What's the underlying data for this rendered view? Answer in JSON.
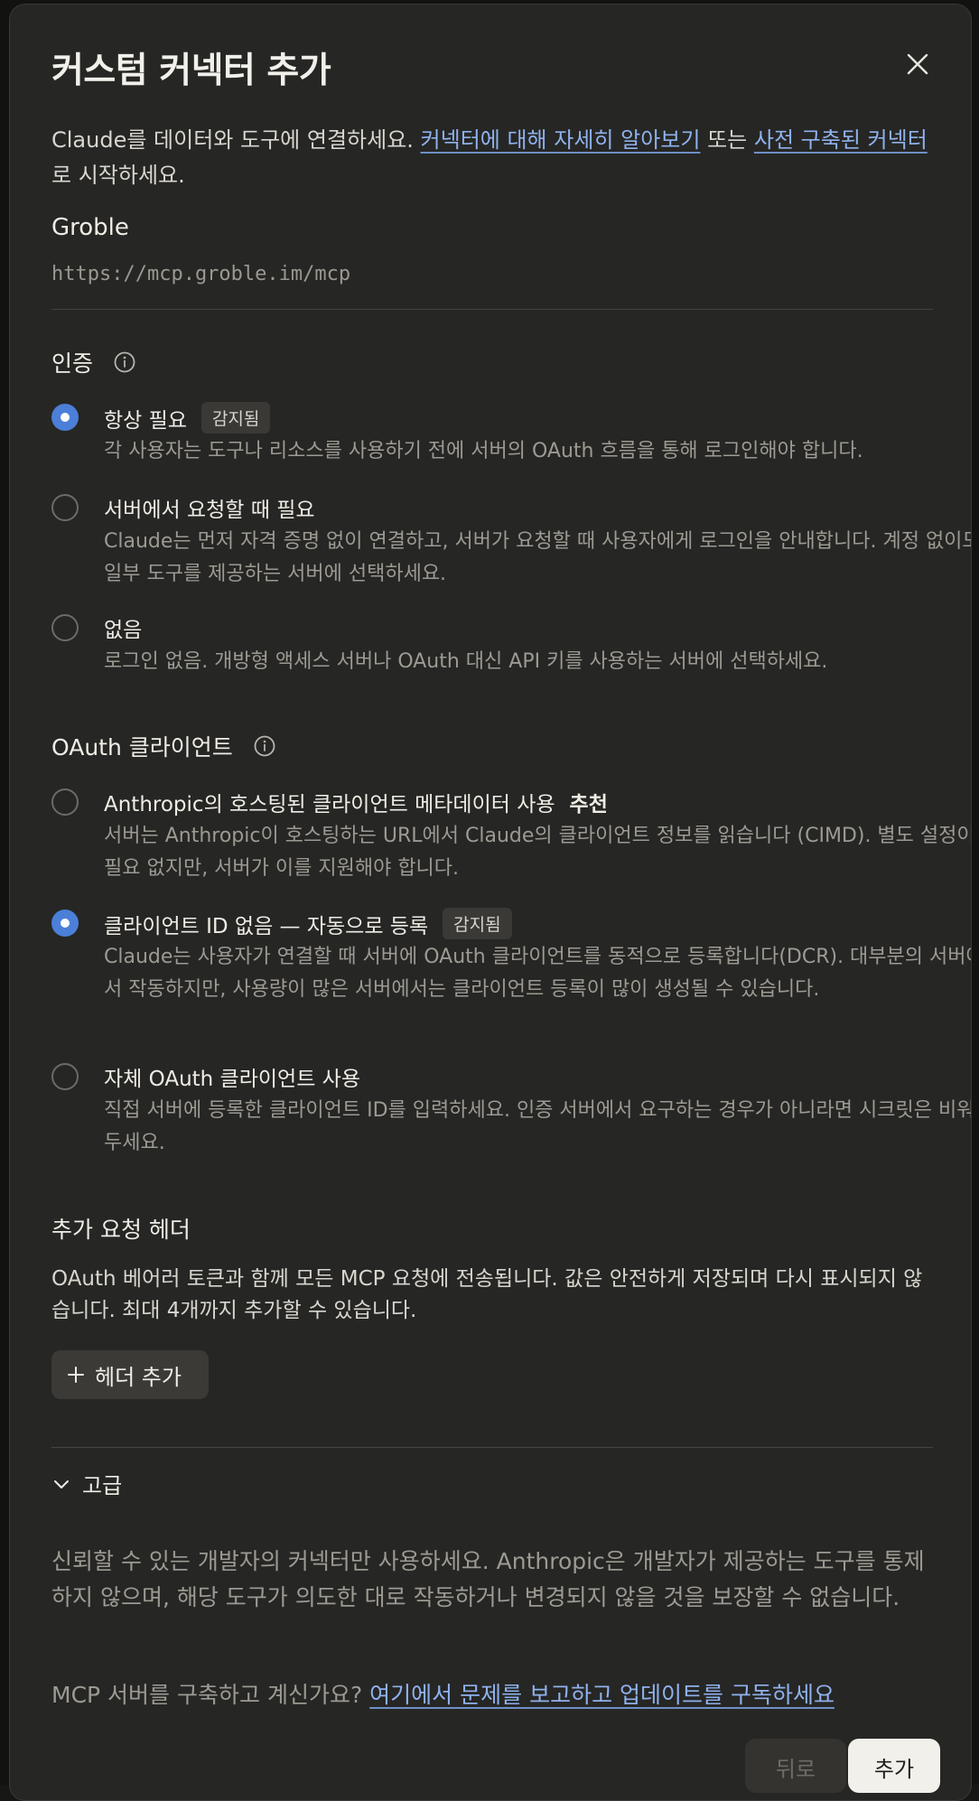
{
  "dialog": {
    "title": "커스텀 커넥터 추가",
    "close_icon": "close-icon"
  },
  "intro": {
    "text_before": "Claude를 데이터와 도구에 연결하세요. ",
    "learn_more_link": "커넥터에 대해 자세히 알아보기",
    "text_middle": " 또는 ",
    "prebuilt_link": "사전 구축된 커넥터",
    "text_after": "로 시작하세요."
  },
  "server": {
    "name": "Groble",
    "url": "https://mcp.groble.im/mcp"
  },
  "auth": {
    "heading": "인증",
    "options": [
      {
        "title": "항상 필요",
        "badge": "감지됨",
        "checked": true,
        "description": "각 사용자는 도구나 리소스를 사용하기 전에 서버의 OAuth 흐름을 통해 로그인해야 합니다."
      },
      {
        "title": "서버에서 요청할 때 필요",
        "checked": false,
        "description": "Claude는 먼저 자격 증명 없이 연결하고, 서버가 요청할 때 사용자에게 로그인을 안내합니다. 계정 없이도 일부 도구를 제공하는 서버에 선택하세요."
      },
      {
        "title": "없음",
        "checked": false,
        "description": "로그인 없음. 개방형 액세스 서버나 OAuth 대신 API 키를 사용하는 서버에 선택하세요."
      }
    ]
  },
  "oauth_client": {
    "heading": "OAuth 클라이언트",
    "options": [
      {
        "title": "Anthropic의 호스팅된 클라이언트 메타데이터 사용",
        "recommend": "추천",
        "checked": false,
        "description": "서버는 Anthropic이 호스팅하는 URL에서 Claude의 클라이언트 정보를 읽습니다 (CIMD). 별도 설정이 필요 없지만, 서버가 이를 지원해야 합니다."
      },
      {
        "title": "클라이언트 ID 없음 — 자동으로 등록",
        "badge": "감지됨",
        "checked": true,
        "description": "Claude는 사용자가 연결할 때 서버에 OAuth 클라이언트를 동적으로 등록합니다(DCR). 대부분의 서버에서 작동하지만, 사용량이 많은 서버에서는 클라이언트 등록이 많이 생성될 수 있습니다."
      },
      {
        "title": "자체 OAuth 클라이언트 사용",
        "checked": false,
        "description": "직접 서버에 등록한 클라이언트 ID를 입력하세요. 인증 서버에서 요구하는 경우가 아니라면 시크릿은 비워 두세요."
      }
    ]
  },
  "headers": {
    "heading": "추가 요청 헤더",
    "description": "OAuth 베어러 토큰과 함께 모든 MCP 요청에 전송됩니다. 값은 안전하게 저장되며 다시 표시되지 않습니다. 최대 4개까지 추가할 수 있습니다.",
    "add_button": "헤더 추가"
  },
  "advanced": {
    "label": "고급"
  },
  "warning": "신뢰할 수 있는 개발자의 커넥터만 사용하세요. Anthropic은 개발자가 제공하는 도구를 통제하지 않으며, 해당 도구가 의도한 대로 작동하거나 변경되지 않을 것을 보장할 수 없습니다.",
  "mcp_note": {
    "text": "MCP 서버를 구축하고 계신가요? ",
    "link": "여기에서 문제를 보고하고 업데이트를 구독하세요"
  },
  "footer": {
    "back_label": "뒤로",
    "add_label": "추가"
  },
  "colors": {
    "accent": "#4b7fd8",
    "link": "#8fb2ee",
    "background": "#262624"
  }
}
